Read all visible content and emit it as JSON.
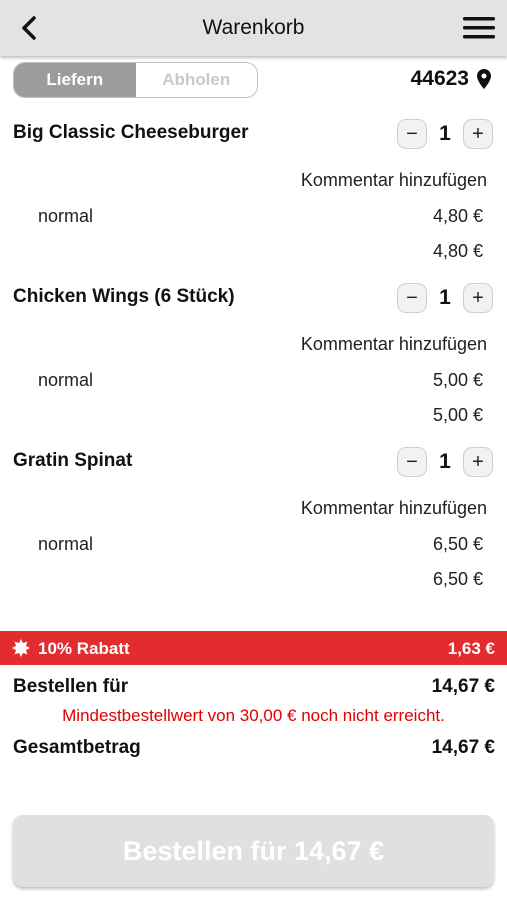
{
  "header": {
    "title": "Warenkorb",
    "back_icon": "chevron-left-icon",
    "menu_icon": "hamburger-menu-icon"
  },
  "mode_toggle": {
    "deliver": "Liefern",
    "pickup": "Abholen",
    "active": "deliver"
  },
  "location": {
    "zip": "44623",
    "icon": "location-pin-icon"
  },
  "items": [
    {
      "name": "Big Classic Cheeseburger",
      "qty": "1",
      "comment": "Kommentar hinzufügen",
      "variant": "normal",
      "variant_price": "4,80 €",
      "total": "4,80 €"
    },
    {
      "name": "Chicken Wings (6 Stück)",
      "qty": "1",
      "comment": "Kommentar hinzufügen",
      "variant": "normal",
      "variant_price": "5,00 €",
      "total": "5,00 €"
    },
    {
      "name": "Gratin Spinat",
      "qty": "1",
      "comment": "Kommentar hinzufügen",
      "variant": "normal",
      "variant_price": "6,50 €",
      "total": "6,50 €"
    }
  ],
  "discount": {
    "label": "10% Rabatt",
    "value": "1,63 €",
    "icon": "badge-icon",
    "color": "#e32c2f"
  },
  "summary": {
    "order_for_label": "Bestellen für",
    "order_for_value": "14,67 €",
    "warning": "Mindestbestellwert von 30,00 € noch nicht erreicht.",
    "total_label": "Gesamtbetrag",
    "total_value": "14,67 €"
  },
  "order_button": {
    "label": "Bestellen für 14,67 €",
    "enabled": false
  }
}
